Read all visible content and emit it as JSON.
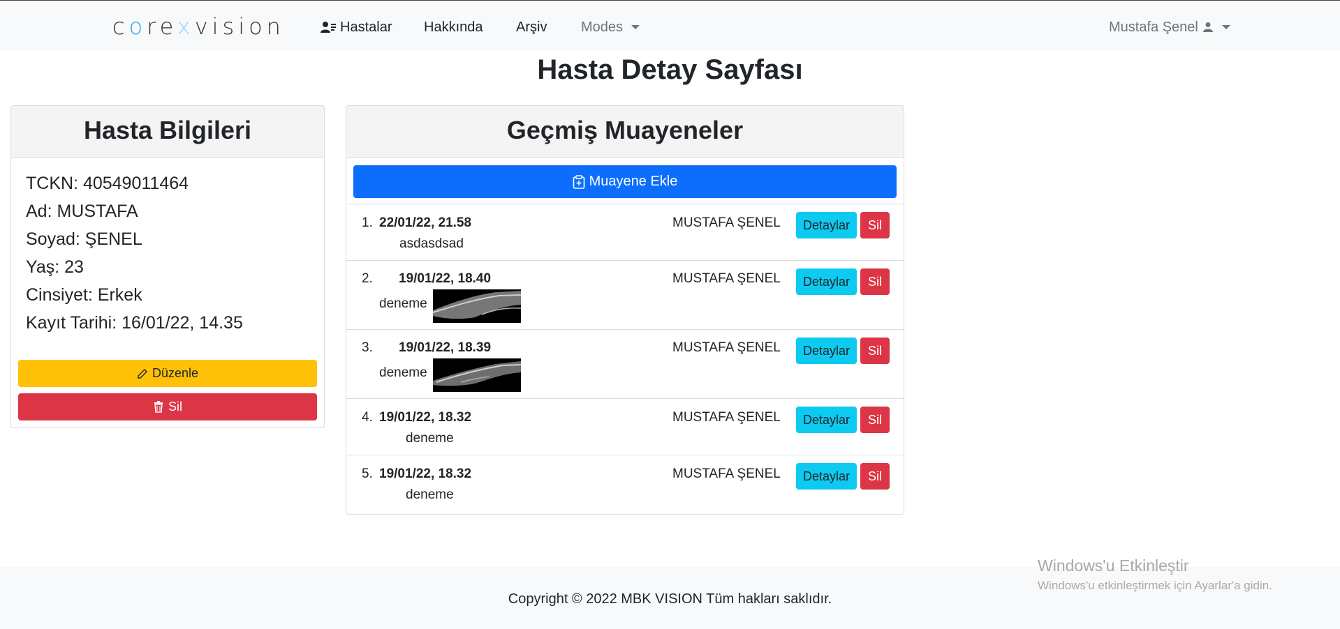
{
  "navbar": {
    "brand": {
      "part1": "c",
      "o1": "o",
      "part2": "re",
      "o2": "x",
      "part3": "vision"
    },
    "items": [
      {
        "label": "Hastalar",
        "icon": "user-list-icon"
      },
      {
        "label": "Hakkında"
      },
      {
        "label": "Arşiv"
      },
      {
        "label": "Modes"
      }
    ],
    "user": {
      "name": "Mustafa Şenel",
      "icon": "user-icon"
    }
  },
  "page": {
    "title": "Hasta Detay Sayfası"
  },
  "patient": {
    "header": "Hasta Bilgileri",
    "lines": [
      "TCKN: 40549011464",
      "Ad: MUSTAFA",
      "Soyad: ŞENEL",
      "Yaş: 23",
      "Cinsiyet: Erkek",
      "Kayıt Tarihi: 16/01/22, 14.35"
    ],
    "edit_label": "Düzenle",
    "delete_label": "Sil"
  },
  "exams": {
    "header": "Geçmiş Muayeneler",
    "add_label": "Muayene Ekle",
    "detail_label": "Detaylar",
    "delete_label": "Sil",
    "items": [
      {
        "num": "1.",
        "date": "22/01/22, 21.58",
        "note": "asdasdsad",
        "doctor": "MUSTAFA ŞENEL",
        "has_image": false
      },
      {
        "num": "2.",
        "date": "19/01/22, 18.40",
        "note": "deneme",
        "doctor": "MUSTAFA ŞENEL",
        "has_image": true
      },
      {
        "num": "3.",
        "date": "19/01/22, 18.39",
        "note": "deneme",
        "doctor": "MUSTAFA ŞENEL",
        "has_image": true
      },
      {
        "num": "4.",
        "date": "19/01/22, 18.32",
        "note": "deneme",
        "doctor": "MUSTAFA ŞENEL",
        "has_image": false
      },
      {
        "num": "5.",
        "date": "19/01/22, 18.32",
        "note": "deneme",
        "doctor": "MUSTAFA ŞENEL",
        "has_image": false
      }
    ]
  },
  "footer": {
    "copyright": "Copyright © 2022 MBK VISION Tüm hakları saklıdır."
  },
  "watermark": {
    "title": "Windows'u Etkinleştir",
    "subtitle": "Windows'u etkinleştirmek için Ayarlar'a gidin."
  },
  "colors": {
    "primary": "#0d6efd",
    "warning": "#ffc107",
    "danger": "#dc3545",
    "info": "#0dcaf0",
    "navbar_bg": "#f8f9fa"
  }
}
